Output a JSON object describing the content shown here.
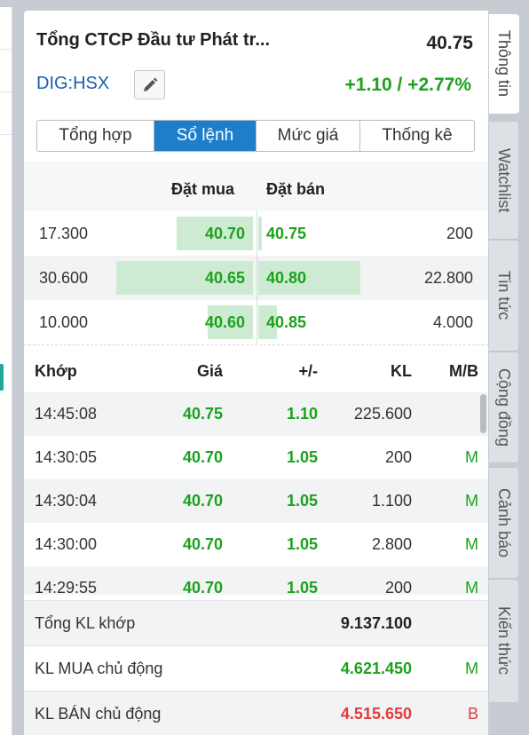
{
  "header": {
    "title": "Tổng CTCP Đầu tư Phát tr...",
    "price": "40.75",
    "ticker": "DIG:HSX",
    "change": "+1.10 / +2.77%",
    "edit_icon": "pencil-icon"
  },
  "tabs": [
    {
      "label": "Tổng hợp",
      "active": false
    },
    {
      "label": "Sổ lệnh",
      "active": true
    },
    {
      "label": "Mức giá",
      "active": false
    },
    {
      "label": "Thống kê",
      "active": false
    }
  ],
  "order_book": {
    "bid_header": "Đặt mua",
    "ask_header": "Đặt bán",
    "rows": [
      {
        "bid_vol": "17.300",
        "bid_price": "40.70",
        "ask_price": "40.75",
        "ask_vol": "200",
        "bid_fill": 0.56,
        "ask_fill": 0.01
      },
      {
        "bid_vol": "30.600",
        "bid_price": "40.65",
        "ask_price": "40.80",
        "ask_vol": "22.800",
        "bid_fill": 1.0,
        "ask_fill": 1.0
      },
      {
        "bid_vol": "10.000",
        "bid_price": "40.60",
        "ask_price": "40.85",
        "ask_vol": "4.000",
        "bid_fill": 0.33,
        "ask_fill": 0.18
      }
    ]
  },
  "trade_log": {
    "headers": {
      "time": "Khớp",
      "price": "Giá",
      "change": "+/-",
      "volume": "KL",
      "side": "M/B"
    },
    "rows": [
      {
        "time": "14:45:08",
        "price": "40.75",
        "change": "1.10",
        "volume": "225.600",
        "side": ""
      },
      {
        "time": "14:30:05",
        "price": "40.70",
        "change": "1.05",
        "volume": "200",
        "side": "M"
      },
      {
        "time": "14:30:04",
        "price": "40.70",
        "change": "1.05",
        "volume": "1.100",
        "side": "M"
      },
      {
        "time": "14:30:00",
        "price": "40.70",
        "change": "1.05",
        "volume": "2.800",
        "side": "M"
      },
      {
        "time": "14:29:55",
        "price": "40.70",
        "change": "1.05",
        "volume": "200",
        "side": "M"
      }
    ]
  },
  "summary": {
    "total_label": "Tổng KL khớp",
    "total_value": "9.137.100",
    "buy_label": "KL MUA chủ động",
    "buy_value": "4.621.450",
    "buy_side": "M",
    "sell_label": "KL BÁN chủ động",
    "sell_value": "4.515.650",
    "sell_side": "B"
  },
  "side_tabs": [
    {
      "label": "Thông tin",
      "active": true
    },
    {
      "label": "Watchlist",
      "active": false
    },
    {
      "label": "Tin tức",
      "active": false
    },
    {
      "label": "Cộng đồng",
      "active": false
    },
    {
      "label": "Cảnh báo",
      "active": false
    },
    {
      "label": "Kiến thức",
      "active": false
    }
  ],
  "colors": {
    "up": "#1ca21c",
    "down": "#e23c3c",
    "accent": "#1d7fcb",
    "ticker": "#1a5fa8",
    "bar": "#cdebd2"
  }
}
